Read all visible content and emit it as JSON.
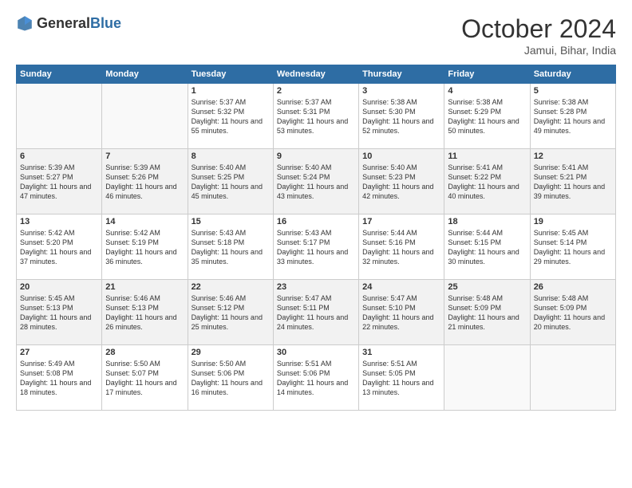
{
  "header": {
    "logo_general": "General",
    "logo_blue": "Blue",
    "month": "October 2024",
    "location": "Jamui, Bihar, India"
  },
  "weekdays": [
    "Sunday",
    "Monday",
    "Tuesday",
    "Wednesday",
    "Thursday",
    "Friday",
    "Saturday"
  ],
  "weeks": [
    [
      {
        "day": "",
        "info": ""
      },
      {
        "day": "",
        "info": ""
      },
      {
        "day": "1",
        "info": "Sunrise: 5:37 AM\nSunset: 5:32 PM\nDaylight: 11 hours and 55 minutes."
      },
      {
        "day": "2",
        "info": "Sunrise: 5:37 AM\nSunset: 5:31 PM\nDaylight: 11 hours and 53 minutes."
      },
      {
        "day": "3",
        "info": "Sunrise: 5:38 AM\nSunset: 5:30 PM\nDaylight: 11 hours and 52 minutes."
      },
      {
        "day": "4",
        "info": "Sunrise: 5:38 AM\nSunset: 5:29 PM\nDaylight: 11 hours and 50 minutes."
      },
      {
        "day": "5",
        "info": "Sunrise: 5:38 AM\nSunset: 5:28 PM\nDaylight: 11 hours and 49 minutes."
      }
    ],
    [
      {
        "day": "6",
        "info": "Sunrise: 5:39 AM\nSunset: 5:27 PM\nDaylight: 11 hours and 47 minutes."
      },
      {
        "day": "7",
        "info": "Sunrise: 5:39 AM\nSunset: 5:26 PM\nDaylight: 11 hours and 46 minutes."
      },
      {
        "day": "8",
        "info": "Sunrise: 5:40 AM\nSunset: 5:25 PM\nDaylight: 11 hours and 45 minutes."
      },
      {
        "day": "9",
        "info": "Sunrise: 5:40 AM\nSunset: 5:24 PM\nDaylight: 11 hours and 43 minutes."
      },
      {
        "day": "10",
        "info": "Sunrise: 5:40 AM\nSunset: 5:23 PM\nDaylight: 11 hours and 42 minutes."
      },
      {
        "day": "11",
        "info": "Sunrise: 5:41 AM\nSunset: 5:22 PM\nDaylight: 11 hours and 40 minutes."
      },
      {
        "day": "12",
        "info": "Sunrise: 5:41 AM\nSunset: 5:21 PM\nDaylight: 11 hours and 39 minutes."
      }
    ],
    [
      {
        "day": "13",
        "info": "Sunrise: 5:42 AM\nSunset: 5:20 PM\nDaylight: 11 hours and 37 minutes."
      },
      {
        "day": "14",
        "info": "Sunrise: 5:42 AM\nSunset: 5:19 PM\nDaylight: 11 hours and 36 minutes."
      },
      {
        "day": "15",
        "info": "Sunrise: 5:43 AM\nSunset: 5:18 PM\nDaylight: 11 hours and 35 minutes."
      },
      {
        "day": "16",
        "info": "Sunrise: 5:43 AM\nSunset: 5:17 PM\nDaylight: 11 hours and 33 minutes."
      },
      {
        "day": "17",
        "info": "Sunrise: 5:44 AM\nSunset: 5:16 PM\nDaylight: 11 hours and 32 minutes."
      },
      {
        "day": "18",
        "info": "Sunrise: 5:44 AM\nSunset: 5:15 PM\nDaylight: 11 hours and 30 minutes."
      },
      {
        "day": "19",
        "info": "Sunrise: 5:45 AM\nSunset: 5:14 PM\nDaylight: 11 hours and 29 minutes."
      }
    ],
    [
      {
        "day": "20",
        "info": "Sunrise: 5:45 AM\nSunset: 5:13 PM\nDaylight: 11 hours and 28 minutes."
      },
      {
        "day": "21",
        "info": "Sunrise: 5:46 AM\nSunset: 5:13 PM\nDaylight: 11 hours and 26 minutes."
      },
      {
        "day": "22",
        "info": "Sunrise: 5:46 AM\nSunset: 5:12 PM\nDaylight: 11 hours and 25 minutes."
      },
      {
        "day": "23",
        "info": "Sunrise: 5:47 AM\nSunset: 5:11 PM\nDaylight: 11 hours and 24 minutes."
      },
      {
        "day": "24",
        "info": "Sunrise: 5:47 AM\nSunset: 5:10 PM\nDaylight: 11 hours and 22 minutes."
      },
      {
        "day": "25",
        "info": "Sunrise: 5:48 AM\nSunset: 5:09 PM\nDaylight: 11 hours and 21 minutes."
      },
      {
        "day": "26",
        "info": "Sunrise: 5:48 AM\nSunset: 5:09 PM\nDaylight: 11 hours and 20 minutes."
      }
    ],
    [
      {
        "day": "27",
        "info": "Sunrise: 5:49 AM\nSunset: 5:08 PM\nDaylight: 11 hours and 18 minutes."
      },
      {
        "day": "28",
        "info": "Sunrise: 5:50 AM\nSunset: 5:07 PM\nDaylight: 11 hours and 17 minutes."
      },
      {
        "day": "29",
        "info": "Sunrise: 5:50 AM\nSunset: 5:06 PM\nDaylight: 11 hours and 16 minutes."
      },
      {
        "day": "30",
        "info": "Sunrise: 5:51 AM\nSunset: 5:06 PM\nDaylight: 11 hours and 14 minutes."
      },
      {
        "day": "31",
        "info": "Sunrise: 5:51 AM\nSunset: 5:05 PM\nDaylight: 11 hours and 13 minutes."
      },
      {
        "day": "",
        "info": ""
      },
      {
        "day": "",
        "info": ""
      }
    ]
  ]
}
